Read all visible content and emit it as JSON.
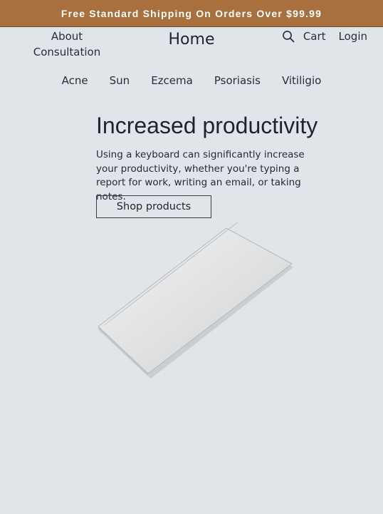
{
  "promo": {
    "text": "Free Standard Shipping On Orders Over $99.99"
  },
  "header": {
    "about_line1": "About",
    "about_line2": "Consultation",
    "logo": "Home",
    "cart": "Cart",
    "login": "Login"
  },
  "nav": {
    "items": [
      "Acne",
      "Sun",
      "Ezcema",
      "Psoriasis",
      "Vitiligio"
    ]
  },
  "hero": {
    "title": "Increased productivity",
    "body": "Using a keyboard can significantly increase your productivity, whether you're typing a report for work, writing an email, or taking notes.",
    "button": "Shop products"
  },
  "colors": {
    "banner": "#a8703f",
    "page_bg": "#e1e4e9",
    "text": "#1f2230"
  },
  "icons": {
    "search": "search-icon"
  }
}
